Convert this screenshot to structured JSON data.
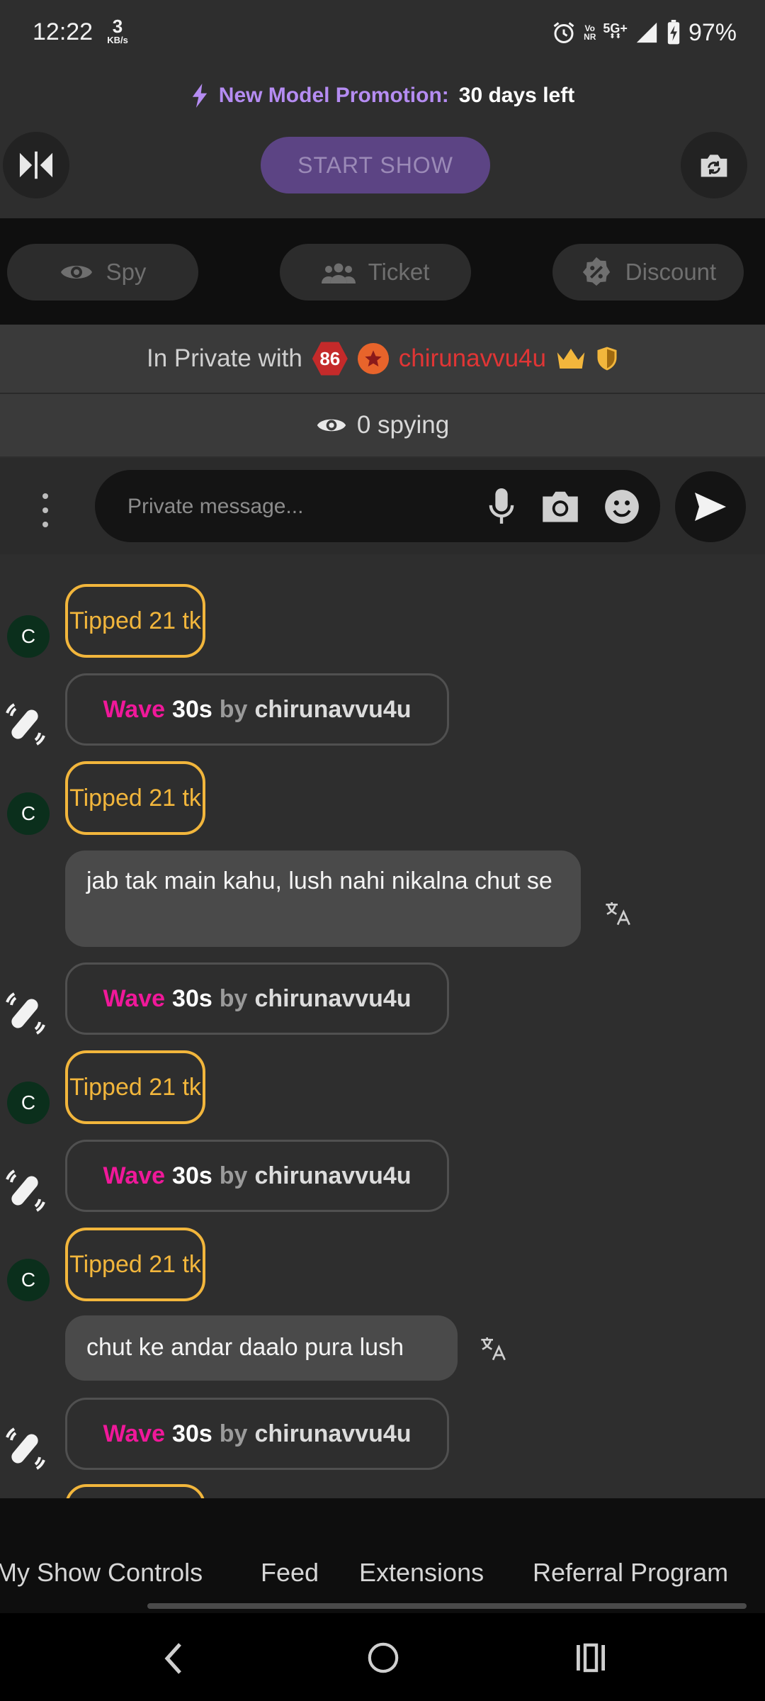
{
  "status_bar": {
    "time": "12:22",
    "net_speed_value": "3",
    "net_speed_unit": "KB/s",
    "volte_line1": "Vo",
    "volte_line2": "NR",
    "network_type": "5G+",
    "battery_percent": "97%"
  },
  "promo": {
    "label": "New Model Promotion:",
    "value": "30 days left"
  },
  "top_controls": {
    "start_show_label": "START SHOW"
  },
  "pills": [
    {
      "label": "Spy",
      "icon": "eye-icon"
    },
    {
      "label": "Ticket",
      "icon": "group-icon"
    },
    {
      "label": "Discount",
      "icon": "percent-badge-icon"
    }
  ],
  "private_info": {
    "prefix": "In Private with",
    "level": "86",
    "username": "chirunavvu4u"
  },
  "spy_info": {
    "text": "0 spying"
  },
  "compose": {
    "placeholder": "Private message..."
  },
  "feed": {
    "avatar_letter": "C",
    "tip_text": "Tipped 21 tk",
    "wave": {
      "word": "Wave",
      "duration": "30s",
      "by": "by",
      "user": "chirunavvu4u"
    },
    "messages": [
      "jab tak main kahu, lush nahi nikalna chut se",
      "chut ke andar daalo pura lush"
    ]
  },
  "tabs": [
    "My Show Controls",
    "Feed",
    "Extensions",
    "Referral Program"
  ],
  "colors": {
    "accent_purple": "#b58cf2",
    "tip_gold": "#f2b63c",
    "wave_pink": "#f0189a",
    "username_red": "#e03535"
  }
}
